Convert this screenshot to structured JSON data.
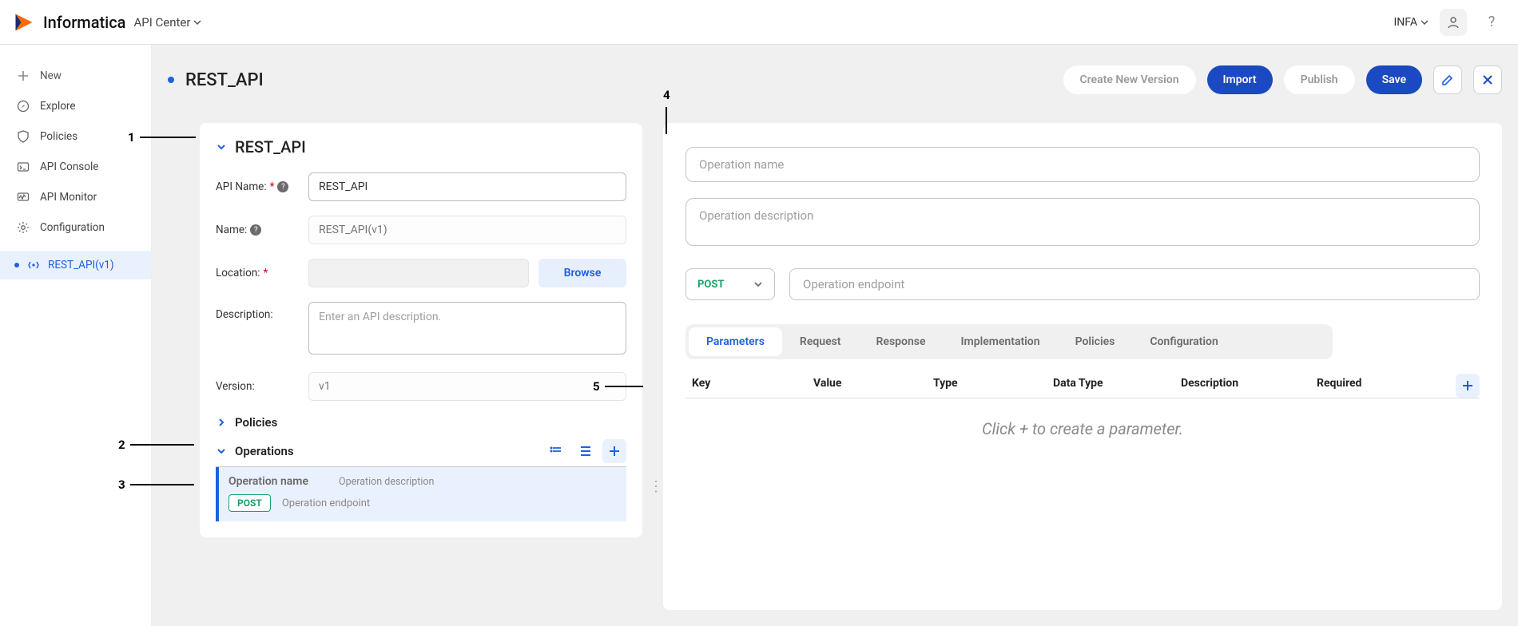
{
  "brand": {
    "name": "Informatica",
    "product": "API Center"
  },
  "org": "INFA",
  "nav": {
    "new": "New",
    "explore": "Explore",
    "policies": "Policies",
    "apiconsole": "API Console",
    "apimonitor": "API Monitor",
    "config": "Configuration",
    "active": "REST_API(v1)"
  },
  "page_title": "REST_API",
  "actions": {
    "create_version": "Create New Version",
    "import": "Import",
    "publish": "Publish",
    "save": "Save"
  },
  "api_panel": {
    "section": "REST_API",
    "labels": {
      "api_name": "API Name:",
      "name": "Name:",
      "location": "Location:",
      "description": "Description:",
      "version": "Version:"
    },
    "values": {
      "api_name": "REST_API",
      "name_placeholder": "REST_API(v1)",
      "description_placeholder": "Enter an API description.",
      "version_placeholder": "v1"
    },
    "browse": "Browse",
    "policies_section": "Policies",
    "operations_section": "Operations",
    "op": {
      "name_placeholder": "Operation name",
      "desc_placeholder": "Operation description",
      "method": "POST",
      "endpoint_placeholder": "Operation endpoint"
    }
  },
  "right_panel": {
    "op_name_placeholder": "Operation name",
    "op_desc_placeholder": "Operation description",
    "method": "POST",
    "endpoint_placeholder": "Operation endpoint",
    "tabs": [
      "Parameters",
      "Request",
      "Response",
      "Implementation",
      "Policies",
      "Configuration"
    ],
    "param_headers": {
      "key": "Key",
      "value": "Value",
      "type": "Type",
      "datatype": "Data Type",
      "desc": "Description",
      "req": "Required"
    },
    "empty_hint": "Click + to create a parameter."
  },
  "annotations": {
    "a1": "1",
    "a2": "2",
    "a3": "3",
    "a4": "4",
    "a5": "5"
  }
}
